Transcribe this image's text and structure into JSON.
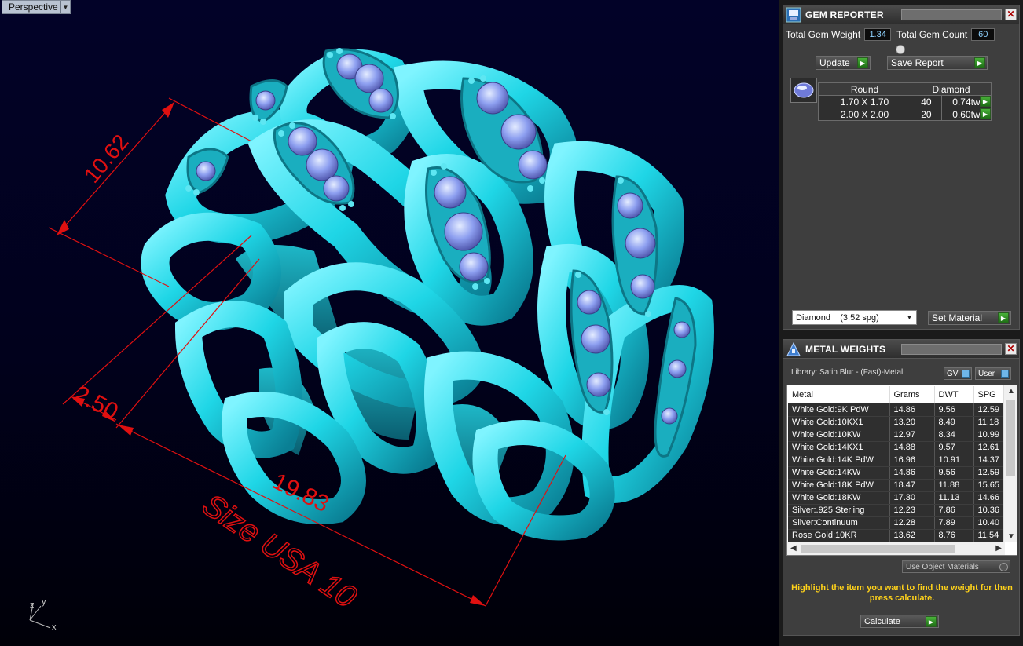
{
  "viewport": {
    "label": "Perspective",
    "dimensions": {
      "height": "10.62",
      "small": "2.50",
      "width": "19.83"
    },
    "size_text": "Size USA 10",
    "axes": {
      "x": "x",
      "y": "y",
      "z": "z"
    }
  },
  "gem_reporter": {
    "title": "GEM REPORTER",
    "total_weight_label": "Total Gem Weight",
    "total_weight_value": "1.34",
    "total_count_label": "Total Gem Count",
    "total_count_value": "60",
    "update_label": "Update",
    "save_label": "Save Report",
    "table": {
      "headers": [
        "Round",
        "Diamond"
      ],
      "rows": [
        {
          "size": "1.70 X 1.70",
          "count": "40",
          "tw": "0.74tw"
        },
        {
          "size": "2.00 X 2.00",
          "count": "20",
          "tw": "0.60tw"
        }
      ]
    },
    "material_select": "Diamond    (3.52 spg)",
    "set_material_label": "Set Material"
  },
  "metal_weights": {
    "title": "METAL WEIGHTS",
    "library": "Library: Satin Blur - (Fast)-Metal",
    "gv_label": "GV",
    "user_label": "User",
    "columns": [
      "Metal",
      "Grams",
      "DWT",
      "SPG"
    ],
    "rows": [
      [
        "White Gold:9K PdW",
        "14.86",
        "9.56",
        "12.59"
      ],
      [
        "White Gold:10KX1",
        "13.20",
        "8.49",
        "11.18"
      ],
      [
        "White Gold:10KW",
        "12.97",
        "8.34",
        "10.99"
      ],
      [
        "White Gold:14KX1",
        "14.88",
        "9.57",
        "12.61"
      ],
      [
        "White Gold:14K PdW",
        "16.96",
        "10.91",
        "14.37"
      ],
      [
        "White Gold:14KW",
        "14.86",
        "9.56",
        "12.59"
      ],
      [
        "White Gold:18K PdW",
        "18.47",
        "11.88",
        "15.65"
      ],
      [
        "White Gold:18KW",
        "17.30",
        "11.13",
        "14.66"
      ],
      [
        "Silver:.925 Sterling",
        "12.23",
        "7.86",
        "10.36"
      ],
      [
        "Silver:Continuum",
        "12.28",
        "7.89",
        "10.40"
      ],
      [
        "Rose Gold:10KR",
        "13.62",
        "8.76",
        "11.54"
      ]
    ],
    "use_object_materials": "Use Object Materials",
    "hint": "Highlight the item you want to find the weight for then press calculate.",
    "calculate_label": "Calculate"
  },
  "colors": {
    "ring": "#1fd6e6",
    "dimension": "#e01010",
    "hint": "#ffd21a",
    "bg": "#01011c"
  }
}
